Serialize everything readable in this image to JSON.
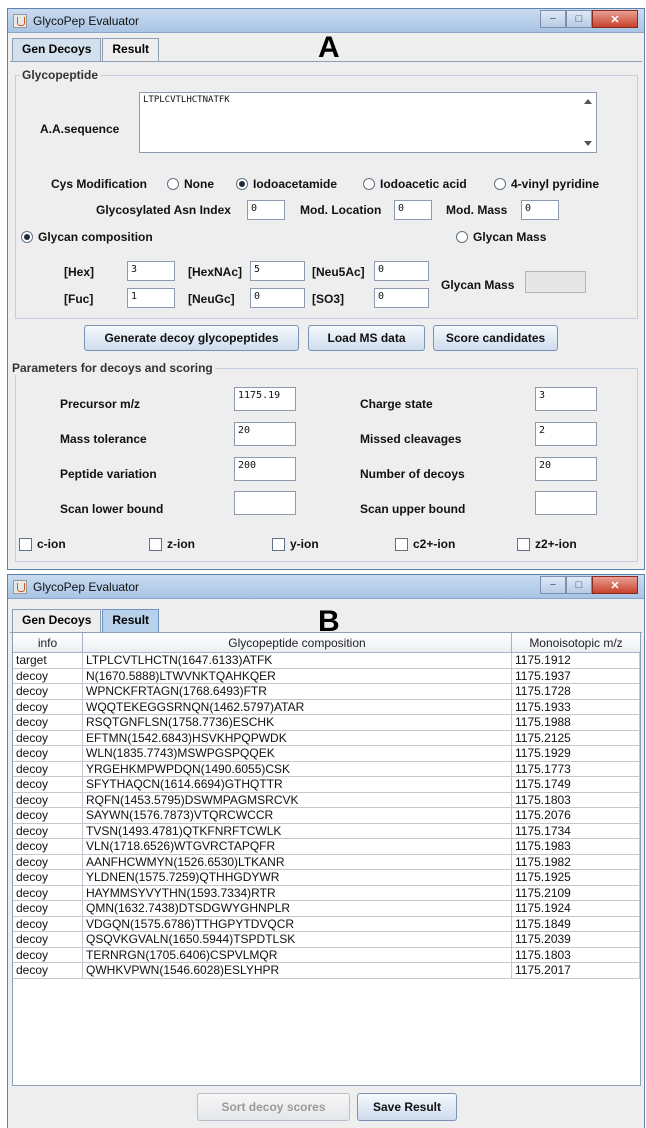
{
  "window_title": "GlycoPep Evaluator",
  "tabs": [
    "Gen Decoys",
    "Result"
  ],
  "panel_letters": {
    "a": "A",
    "b": "B"
  },
  "glycopeptide": {
    "group_title": "Glycopeptide",
    "aa_label": "A.A.sequence",
    "aa_value": "LTPLCVTLHCTNATFK",
    "cys_label": "Cys Modification",
    "cys_options": [
      "None",
      "Iodoacetamide",
      "Iodoacetic acid",
      "4-vinyl pyridine"
    ],
    "cys_selected": "Iodoacetamide",
    "asn_label": "Glycosylated Asn Index",
    "asn_value": "0",
    "modloc_label": "Mod. Location",
    "modloc_value": "0",
    "modmass_label": "Mod. Mass",
    "modmass_value": "0",
    "glycan_comp_label": "Glycan composition",
    "glycan_mass_radio_label": "Glycan Mass",
    "glycan_mode_selected": "Glycan composition",
    "hex_label": "[Hex]",
    "hex_value": "3",
    "hexnac_label": "[HexNAc]",
    "hexnac_value": "5",
    "neu5ac_label": "[Neu5Ac]",
    "neu5ac_value": "0",
    "fuc_label": "[Fuc]",
    "fuc_value": "1",
    "neugc_label": "[NeuGc]",
    "neugc_value": "0",
    "so3_label": "[SO3]",
    "so3_value": "0",
    "glycan_mass_label": "Glycan Mass",
    "glycan_mass_value": ""
  },
  "actions": {
    "generate": "Generate decoy glycopeptides",
    "load": "Load MS data",
    "score": "Score candidates"
  },
  "params": {
    "group_title": "Parameters for decoys and scoring",
    "precursor_label": "Precursor m/z",
    "precursor_value": "1175.19",
    "charge_label": "Charge state",
    "charge_value": "3",
    "masstol_label": "Mass tolerance",
    "masstol_value": "20",
    "missed_label": "Missed cleavages",
    "missed_value": "2",
    "pepvar_label": "Peptide variation",
    "pepvar_value": "200",
    "numdecoys_label": "Number of decoys",
    "numdecoys_value": "20",
    "scanlow_label": "Scan lower bound",
    "scanlow_value": "",
    "scanup_label": "Scan upper bound",
    "scanup_value": ""
  },
  "ions": [
    "c-ion",
    "z-ion",
    "y-ion",
    "c2+-ion",
    "z2+-ion"
  ],
  "result": {
    "headers": [
      "info",
      "Glycopeptide composition",
      "Monoisotopic m/z"
    ],
    "rows": [
      [
        "target",
        "LTPLCVTLHCTN(1647.6133)ATFK",
        "1175.1912"
      ],
      [
        "decoy",
        "N(1670.5888)LTWVNKTQAHKQER",
        "1175.1937"
      ],
      [
        "decoy",
        "WPNCKFRTAGN(1768.6493)FTR",
        "1175.1728"
      ],
      [
        "decoy",
        "WQQTEKEGGSRNQN(1462.5797)ATAR",
        "1175.1933"
      ],
      [
        "decoy",
        "RSQTGNFLSN(1758.7736)ESCHK",
        "1175.1988"
      ],
      [
        "decoy",
        "EFTMN(1542.6843)HSVKHPQPWDK",
        "1175.2125"
      ],
      [
        "decoy",
        "WLN(1835.7743)MSWPGSPQQEK",
        "1175.1929"
      ],
      [
        "decoy",
        "YRGEHKMPWPDQN(1490.6055)CSK",
        "1175.1773"
      ],
      [
        "decoy",
        "SFYTHAQCN(1614.6694)GTHQTTR",
        "1175.1749"
      ],
      [
        "decoy",
        "RQFN(1453.5795)DSWMPAGMSRCVK",
        "1175.1803"
      ],
      [
        "decoy",
        "SAYWN(1576.7873)VTQRCWCCR",
        "1175.2076"
      ],
      [
        "decoy",
        "TVSN(1493.4781)QTKFNRFTCWLK",
        "1175.1734"
      ],
      [
        "decoy",
        "VLN(1718.6526)WTGVRCTAPQFR",
        "1175.1983"
      ],
      [
        "decoy",
        "AANFHCWMYN(1526.6530)LTKANR",
        "1175.1982"
      ],
      [
        "decoy",
        "YLDNEN(1575.7259)QTHHGDYWR",
        "1175.1925"
      ],
      [
        "decoy",
        "HAYMMSYVYTHN(1593.7334)RTR",
        "1175.2109"
      ],
      [
        "decoy",
        "QMN(1632.7438)DTSDGWYGHNPLR",
        "1175.1924"
      ],
      [
        "decoy",
        "VDGQN(1575.6786)TTHGPYTDVQCR",
        "1175.1849"
      ],
      [
        "decoy",
        "QSQVKGVALN(1650.5944)TSPDTLSK",
        "1175.2039"
      ],
      [
        "decoy",
        "TERNRGN(1705.6406)CSPVLMQR",
        "1175.1803"
      ],
      [
        "decoy",
        "QWHKVPWN(1546.6028)ESLYHPR",
        "1175.2017"
      ]
    ],
    "sort_button": "Sort decoy scores",
    "save_button": "Save Result"
  }
}
